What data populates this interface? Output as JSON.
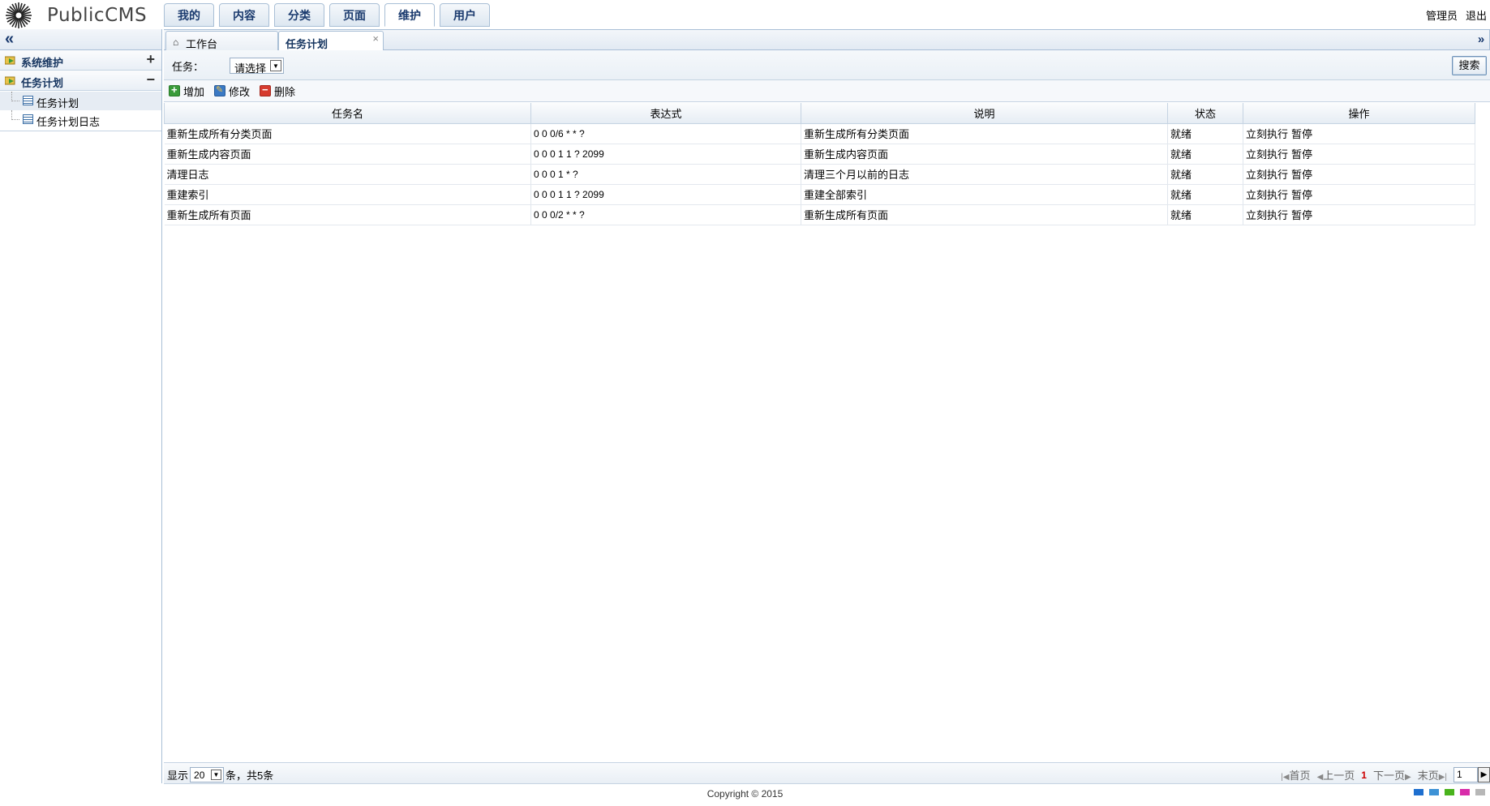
{
  "header": {
    "logo_text": "PublicCMS",
    "nav": [
      "我的",
      "内容",
      "分类",
      "页面",
      "维护",
      "用户"
    ],
    "active_nav": "维护",
    "user": "管理员",
    "logout": "退出"
  },
  "sidebar": {
    "sections": [
      {
        "label": "系统维护",
        "toggle": "+"
      },
      {
        "label": "任务计划",
        "toggle": "−",
        "items": [
          "任务计划",
          "任务计划日志"
        ]
      }
    ]
  },
  "tabs": {
    "home": "工作台",
    "active": "任务计划",
    "close": "×"
  },
  "search": {
    "label": "任务：",
    "select_value": "请选择",
    "button": "搜索"
  },
  "toolbar": {
    "add": "增加",
    "edit": "修改",
    "delete": "删除"
  },
  "grid": {
    "columns": [
      "任务名",
      "表达式",
      "说明",
      "状态",
      "操作"
    ],
    "rows": [
      {
        "name": "重新生成所有分类页面",
        "expr": "0 0 0/6 * * ?",
        "desc": "重新生成所有分类页面",
        "status": "就绪"
      },
      {
        "name": "重新生成内容页面",
        "expr": "0 0 0 1 1 ? 2099",
        "desc": "重新生成内容页面",
        "status": "就绪"
      },
      {
        "name": "清理日志",
        "expr": "0 0 0 1 * ?",
        "desc": "清理三个月以前的日志",
        "status": "就绪"
      },
      {
        "name": "重建索引",
        "expr": "0 0 0 1 1 ? 2099",
        "desc": "重建全部索引",
        "status": "就绪"
      },
      {
        "name": "重新生成所有页面",
        "expr": "0 0 0/2 * * ?",
        "desc": "重新生成所有页面",
        "status": "就绪"
      }
    ],
    "ops": [
      "立刻执行",
      "暂停"
    ]
  },
  "pager": {
    "show": "显示",
    "page_size": "20",
    "summary": "条，共5条",
    "first": "首页",
    "prev": "上一页",
    "current": "1",
    "next": "下一页",
    "last": "末页",
    "page_input": "1"
  },
  "footer": "Copyright © 2015",
  "themes": [
    "#1e6fcf",
    "#3d92d6",
    "#49b31c",
    "#d82ca9",
    "#b7b7b7"
  ]
}
